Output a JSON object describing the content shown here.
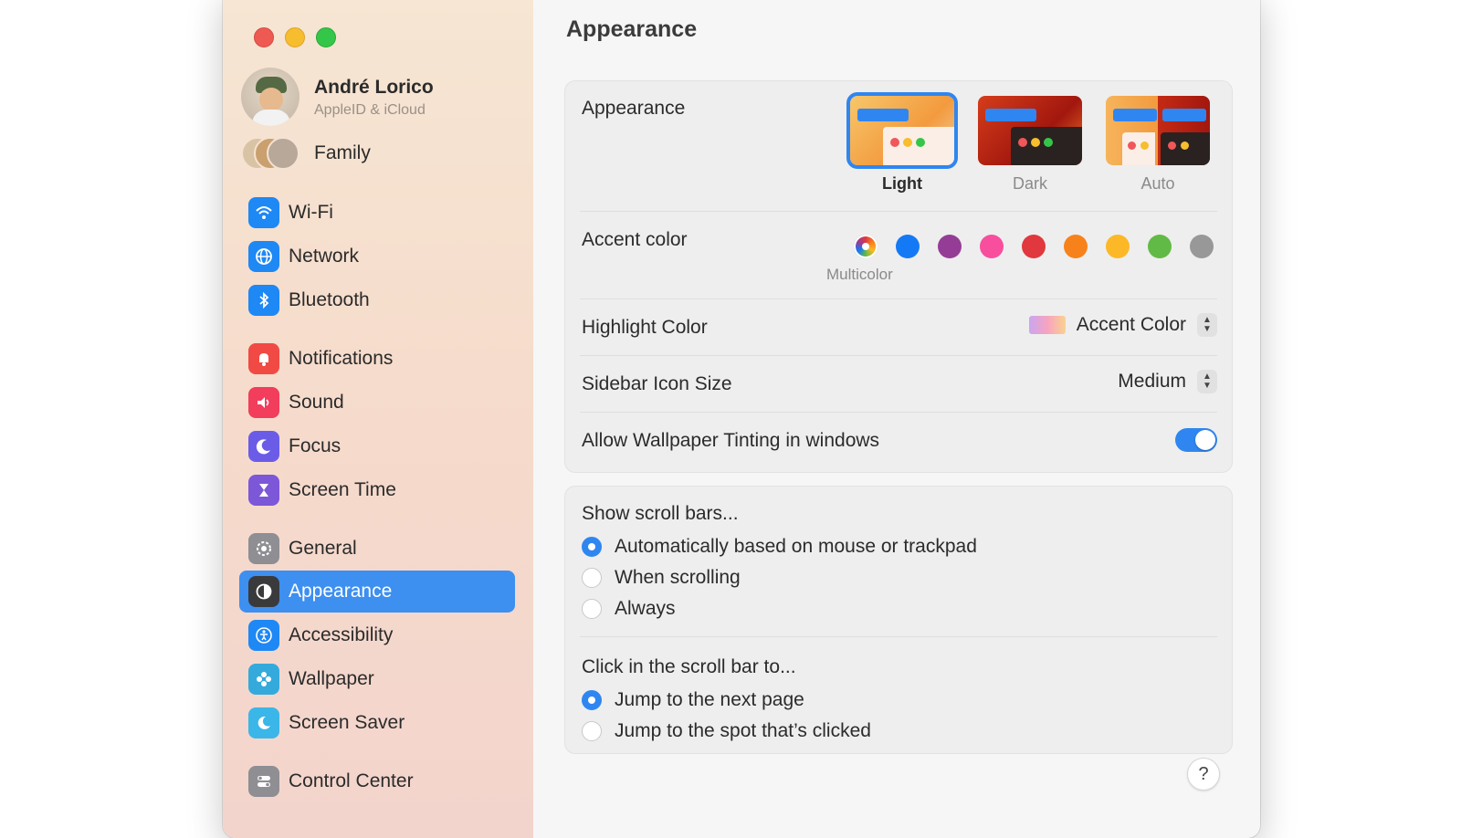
{
  "sidebar": {
    "profile": {
      "name": "André Lorico",
      "subtitle": "AppleID & iCloud"
    },
    "family_label": "Family",
    "items": [
      {
        "label": "Wi‑Fi",
        "icon": "wifi-icon",
        "color": "#1e88f5",
        "selected": false
      },
      {
        "label": "Network",
        "icon": "globe-icon",
        "color": "#1e88f5",
        "selected": false
      },
      {
        "label": "Bluetooth",
        "icon": "bluetooth-icon",
        "color": "#1e88f5",
        "selected": false
      },
      {
        "label": "Notifications",
        "icon": "bell-icon",
        "color": "#f14a44",
        "selected": false
      },
      {
        "label": "Sound",
        "icon": "speaker-icon",
        "color": "#f23d5c",
        "selected": false
      },
      {
        "label": "Focus",
        "icon": "moon-icon",
        "color": "#6b5ce7",
        "selected": false
      },
      {
        "label": "Screen Time",
        "icon": "hourglass-icon",
        "color": "#7c57d8",
        "selected": false
      },
      {
        "label": "General",
        "icon": "gear-icon",
        "color": "#8e8e93",
        "selected": false
      },
      {
        "label": "Appearance",
        "icon": "appearance-icon",
        "color": "#3a3a3c",
        "selected": true
      },
      {
        "label": "Accessibility",
        "icon": "accessibility-icon",
        "color": "#1e88f5",
        "selected": false
      },
      {
        "label": "Wallpaper",
        "icon": "flower-icon",
        "color": "#34aadc",
        "selected": false
      },
      {
        "label": "Screen Saver",
        "icon": "screensaver-icon",
        "color": "#3bb6e8",
        "selected": false
      },
      {
        "label": "Control Center",
        "icon": "switches-icon",
        "color": "#8e8e93",
        "selected": false
      }
    ]
  },
  "main": {
    "title": "Appearance",
    "appearance": {
      "label": "Appearance",
      "options": [
        {
          "label": "Light",
          "selected": true
        },
        {
          "label": "Dark",
          "selected": false
        },
        {
          "label": "Auto",
          "selected": false
        }
      ]
    },
    "accent": {
      "label": "Accent color",
      "selected_caption": "Multicolor",
      "colors": [
        "multicolor",
        "#1479f5",
        "#953d96",
        "#f74f9e",
        "#e0383e",
        "#f7821b",
        "#fcb827",
        "#62ba46",
        "#989898"
      ]
    },
    "highlight": {
      "label": "Highlight Color",
      "value": "Accent Color"
    },
    "sidebar_icon_size": {
      "label": "Sidebar Icon Size",
      "value": "Medium"
    },
    "wallpaper_tinting": {
      "label": "Allow Wallpaper Tinting in windows",
      "on": true
    },
    "scroll_bars": {
      "label": "Show scroll bars...",
      "options": [
        {
          "label": "Automatically based on mouse or trackpad",
          "selected": true
        },
        {
          "label": "When scrolling",
          "selected": false
        },
        {
          "label": "Always",
          "selected": false
        }
      ]
    },
    "click_scroll": {
      "label": "Click in the scroll bar to...",
      "options": [
        {
          "label": "Jump to the next page",
          "selected": true
        },
        {
          "label": "Jump to the spot that’s clicked",
          "selected": false
        }
      ]
    },
    "help_label": "?"
  }
}
